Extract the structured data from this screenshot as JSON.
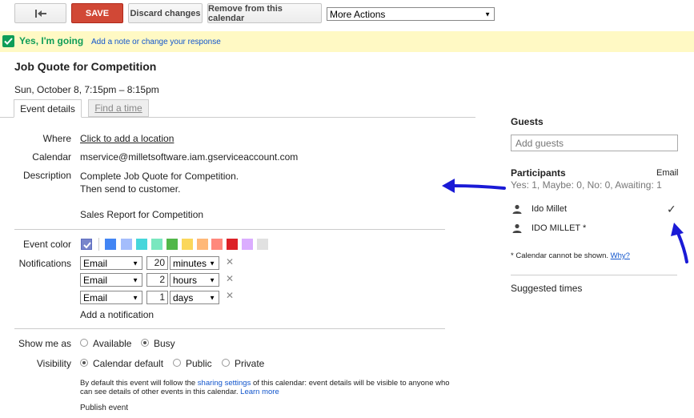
{
  "toolbar": {
    "back_icon": "back-arrow-icon",
    "save_label": "SAVE",
    "discard_label": "Discard changes",
    "remove_label": "Remove from this calendar",
    "more_actions": "More Actions"
  },
  "rsvp": {
    "status": "Yes, I'm going",
    "note_link": "Add a note or change your response"
  },
  "event": {
    "title": "Job Quote for Competition",
    "datetime": "Sun, October 8, 7:15pm – 8:15pm"
  },
  "tabs": {
    "details": "Event details",
    "find_time": "Find a time"
  },
  "fields": {
    "where_label": "Where",
    "where_link": "Click to add a location",
    "calendar_label": "Calendar",
    "calendar_value": "mservice@milletsoftware.iam.gserviceaccount.com",
    "description_label": "Description",
    "description_lines": [
      "Complete Job Quote for Competition.",
      "Then send to customer.",
      "",
      "Sales Report for Competition"
    ]
  },
  "event_color": {
    "label": "Event color",
    "swatches": [
      "#7986cb",
      "#4285f4",
      "#a4bdfc",
      "#46d6db",
      "#7ae7bf",
      "#51b749",
      "#fbd75b",
      "#ffb878",
      "#ff887c",
      "#dc2127",
      "#dbadff",
      "#e1e1e1"
    ]
  },
  "notifications": {
    "label": "Notifications",
    "items": [
      {
        "method": "Email",
        "amount": "20",
        "unit": "minutes"
      },
      {
        "method": "Email",
        "amount": "2",
        "unit": "hours"
      },
      {
        "method": "Email",
        "amount": "1",
        "unit": "days"
      }
    ],
    "add_link": "Add a notification"
  },
  "show_me_as": {
    "label": "Show me as",
    "available": "Available",
    "busy": "Busy"
  },
  "visibility": {
    "label": "Visibility",
    "options": [
      "Calendar default",
      "Public",
      "Private"
    ],
    "note_prefix": "By default this event will follow the ",
    "note_link": "sharing settings",
    "note_suffix": " of this calendar: event details will be visible to anyone who",
    "note_line2": "can see details of other events in this calendar.",
    "learn_more": "Learn more"
  },
  "publish": "Publish event",
  "guests": {
    "title": "Guests",
    "placeholder": "Add guests",
    "participants_title": "Participants",
    "email_link": "Email",
    "summary": "Yes: 1, Maybe: 0, No: 0, Awaiting: 1",
    "list": [
      {
        "name": "Ido Millet",
        "mark": "✓"
      },
      {
        "name": "IDO MILLET *",
        "mark": ""
      }
    ],
    "calendar_note": "* Calendar cannot be shown.",
    "why_link": "Why?",
    "suggested_times": "Suggested times"
  },
  "colors": {
    "accent_link": "#1155cc",
    "save_red": "#d14836",
    "rsvp_green": "#0f9d58",
    "annotation_arrow": "#1a1ad6"
  }
}
